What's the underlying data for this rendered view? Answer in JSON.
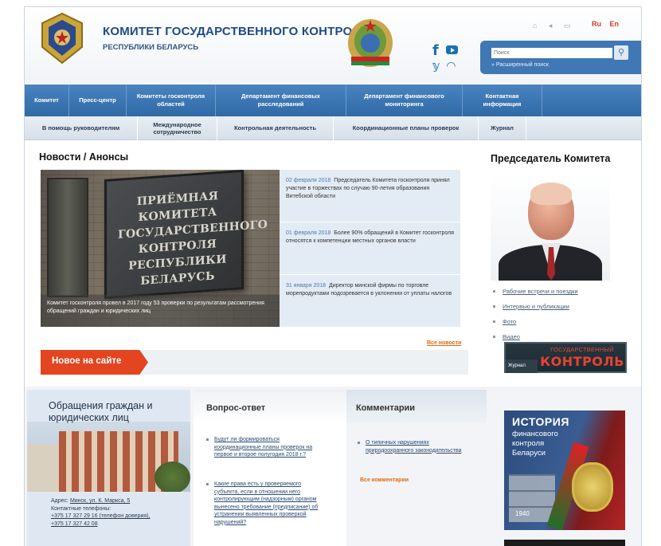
{
  "header": {
    "title": "КОМИТЕТ ГОСУДАРСТВЕННОГО КОНТРОЛЯ",
    "subtitle": "РЕСПУБЛИКИ БЕЛАРУСЬ",
    "lang_ru": "Ru",
    "lang_en": "En",
    "util_icons": "⌂ ◂ ▭",
    "search_placeholder": "Поиск",
    "advanced_search": "» Расширенный поиск"
  },
  "nav_main": [
    "Комитет",
    "Пресс-центр",
    "Комитеты госконтроля областей",
    "Департамент финансовых расследований",
    "Департамент финансового мониторинга",
    "Контактная информация"
  ],
  "nav_sub": [
    "В помощь руководителям",
    "Международное сотрудничество",
    "Контрольная деятельность",
    "Координационные планы проверок",
    "Журнал"
  ],
  "news": {
    "title": "Новости / Анонсы",
    "plaque_text": "ПРИЁМНАЯ КОМИТЕТА ГОСУДАРСТВЕННОГО КОНТРОЛЯ РЕСПУБЛИКИ БЕЛАРУСЬ",
    "photo_caption": "Комитет госконтроля провел в 2017 году 53 проверки по результатам рассмотрения обращений граждан и юридических лиц",
    "items": [
      {
        "date": "02 февраля 2018",
        "text": "Председатель Комитета госконтроля принял участие в торжествах по случаю 90-летия образования Витебской области"
      },
      {
        "date": "01 февраля 2018",
        "text": "Более 90% обращений в Комитет госконтроля относятся к компетенции местных органов власти"
      },
      {
        "date": "31 января 2018",
        "text": "Директор минской фирмы по торговле морепродуктами подозревается в уклонении от уплаты налогов"
      }
    ],
    "all_news": "Все новости"
  },
  "chairman": {
    "title": "Председатель Комитета",
    "links": [
      "Рабочие встречи и поездки",
      "Интервью и публикации",
      "Фото",
      "Видео"
    ]
  },
  "journal": {
    "small": "Журнал",
    "top": "ГОСУДАРСТВЕННЫЙ",
    "big": "КОНТРОЛЬ"
  },
  "new_on_site": "Новое на сайте",
  "appeals": {
    "title": "Обращения граждан и юридических лиц",
    "address_label": "Адрес: ",
    "address": "Минск, ул. К. Маркса, 5",
    "phones_label": "Контактные телефоны:",
    "phone1": "+375 17 327 29 16 (телефон доверия),",
    "phone2": "+375 17 327 42 08"
  },
  "qa": {
    "title": "Вопрос-ответ",
    "items": [
      "Будут ли формироваться координационные планы проверок на первое и второе полугодия 2018 г.?",
      "Какие права есть у проверяемого субъекта, если в отношении него контролирующим (надзорным) органом вынесено требование (предписание) об устранении выявленных проверкой нарушений?"
    ]
  },
  "comments": {
    "title": "Комментарии",
    "items": [
      "О типичных нарушениях природоохранного законодательства"
    ],
    "all": "Все комментарии"
  },
  "history_banner": {
    "line1": "ИСТОРИЯ",
    "line2": "финансового контроля Беларуси",
    "year": "1940"
  }
}
